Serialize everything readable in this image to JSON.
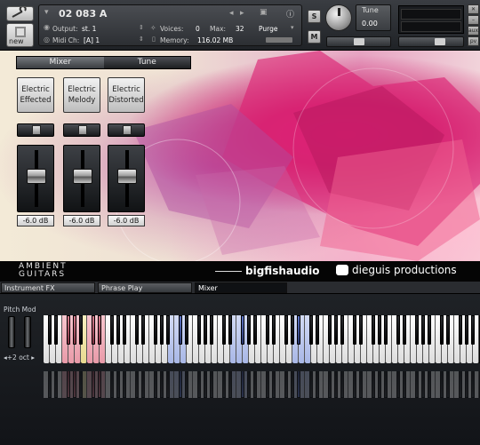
{
  "header": {
    "instrument_name": "02 083 A",
    "output_label": "Output:",
    "output_value": "st. 1",
    "voices_label": "Voices:",
    "voices_value": "0",
    "max_label": "Max:",
    "max_value": "32",
    "purge_label": "Purge",
    "midi_label": "Midi Ch:",
    "midi_value": "[A]  1",
    "memory_label": "Memory:",
    "memory_value": "116.02 MB",
    "new_label": "new",
    "solo_label": "S",
    "mute_label": "M",
    "tune_label": "Tune",
    "tune_value": "0.00",
    "aux_label": "aux",
    "pv_label": "pv"
  },
  "panel": {
    "tabs": [
      "Mixer",
      "Tune"
    ],
    "active_tab": "Mixer",
    "channels": [
      {
        "name": "Electric Effected",
        "db": "-6.0 dB"
      },
      {
        "name": "Electric Melody",
        "db": "-6.0 dB"
      },
      {
        "name": "Electric Distorted",
        "db": "-6.0 dB"
      }
    ]
  },
  "brand": {
    "left": "AMBIENT GUITARS",
    "middle": "bigfishaudio",
    "right": "dieguis productions"
  },
  "bottom_tabs": [
    "Instrument FX",
    "Phrase Play",
    "Mixer"
  ],
  "keyboard": {
    "pitch_label": "Pitch Mod",
    "octave_label": "◂+2 oct ▸"
  },
  "colors": {
    "accent_pink": "#e6197a",
    "key_red": "#f8c6cf",
    "key_blue": "#d3dbf5",
    "key_yellow": "#f8efc0"
  }
}
